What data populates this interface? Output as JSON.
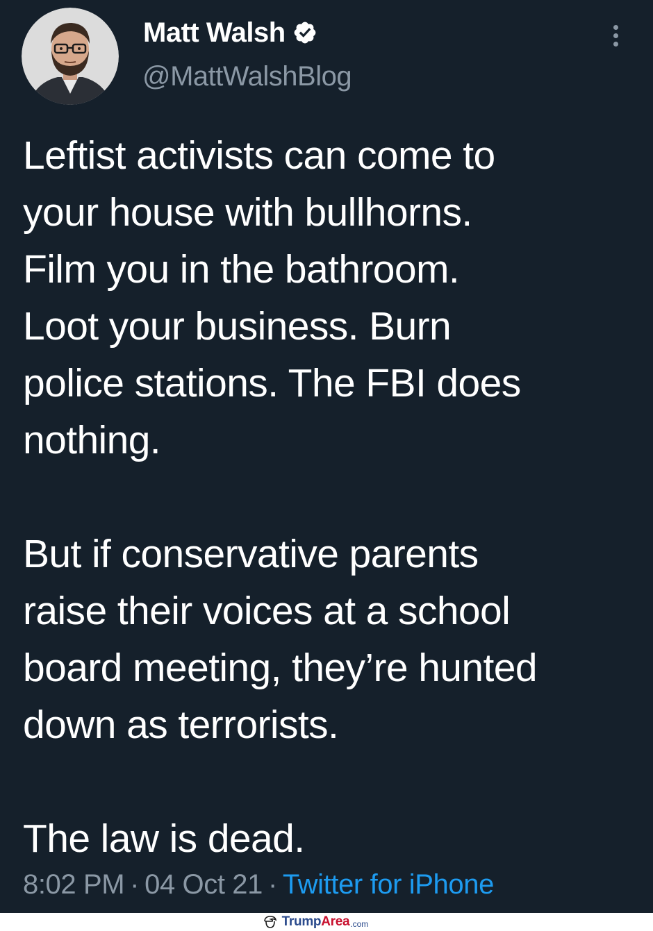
{
  "tweet": {
    "author": {
      "display_name": "Matt Walsh",
      "handle": "@MattWalshBlog",
      "verified": true,
      "avatar_icon": "profile-photo"
    },
    "body": {
      "paragraph_1": "Leftist activists can come to\nyour house with bullhorns.\nFilm you in the bathroom.\nLoot your business. Burn\npolice stations. The FBI does\nnothing.",
      "paragraph_2": "But if conservative parents\nraise their voices at a school\nboard meeting, they’re hunted\ndown as terrorists.",
      "paragraph_3": "The law is dead."
    },
    "meta": {
      "time": "8:02 PM",
      "separator": "·",
      "date": "04 Oct 21",
      "source": "Twitter for iPhone"
    },
    "more_icon": "more-vertical-icon"
  },
  "watermark": {
    "brand_part_1": "Trump",
    "brand_part_2": "Area",
    "brand_suffix": ".com"
  },
  "colors": {
    "background": "#15202b",
    "primary_text": "#ffffff",
    "secondary_text": "#8b98a5",
    "link": "#1d9bf0"
  }
}
